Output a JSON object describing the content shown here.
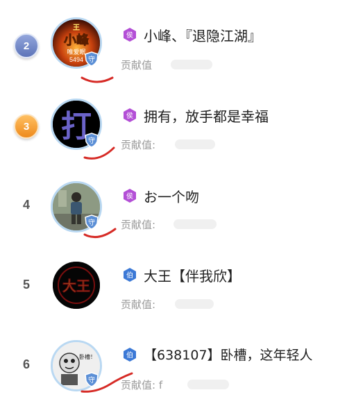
{
  "leaderboard": {
    "rows": [
      {
        "rank": "2",
        "badge_style": "silver",
        "title_icon": "hou-badge-icon",
        "title_char": "侯",
        "username": "小峰、『退隐江湖』",
        "contribution_label": "贡献值"
      },
      {
        "rank": "3",
        "badge_style": "bronze",
        "title_icon": "hou-badge-icon",
        "title_char": "侯",
        "username": "拥有，放手都是幸福",
        "contribution_label": "贡献值:"
      },
      {
        "rank": "4",
        "badge_style": "plain",
        "title_icon": "hou-badge-icon",
        "title_char": "侯",
        "username": "お一个吻",
        "contribution_label": "贡献值:"
      },
      {
        "rank": "5",
        "badge_style": "plain",
        "title_icon": "bo-badge-icon",
        "title_char": "伯",
        "username": "大王【伴我欣】",
        "contribution_label": "贡献值:"
      },
      {
        "rank": "6",
        "badge_style": "plain",
        "title_icon": "bo-badge-icon",
        "title_char": "伯",
        "username": "【638107】卧槽，这年轻人",
        "contribution_label": "贡献值: f"
      }
    ],
    "guard_char": "守",
    "avatar_texts": {
      "row2_top": "王",
      "row2_main": "小峰",
      "row2_sub": "唯爱眠",
      "row2_num": "5494",
      "row3_main": "打",
      "row5_main": "大王",
      "row6_side": "卧槽！"
    },
    "colors": {
      "silver_badge": "#6f86c4",
      "bronze_badge": "#f5a43a",
      "hou_badge": "#b34fd6",
      "bo_badge": "#3c79d6",
      "scribble": "#d62b26",
      "avatar_ring": "#b9d8f2"
    }
  }
}
